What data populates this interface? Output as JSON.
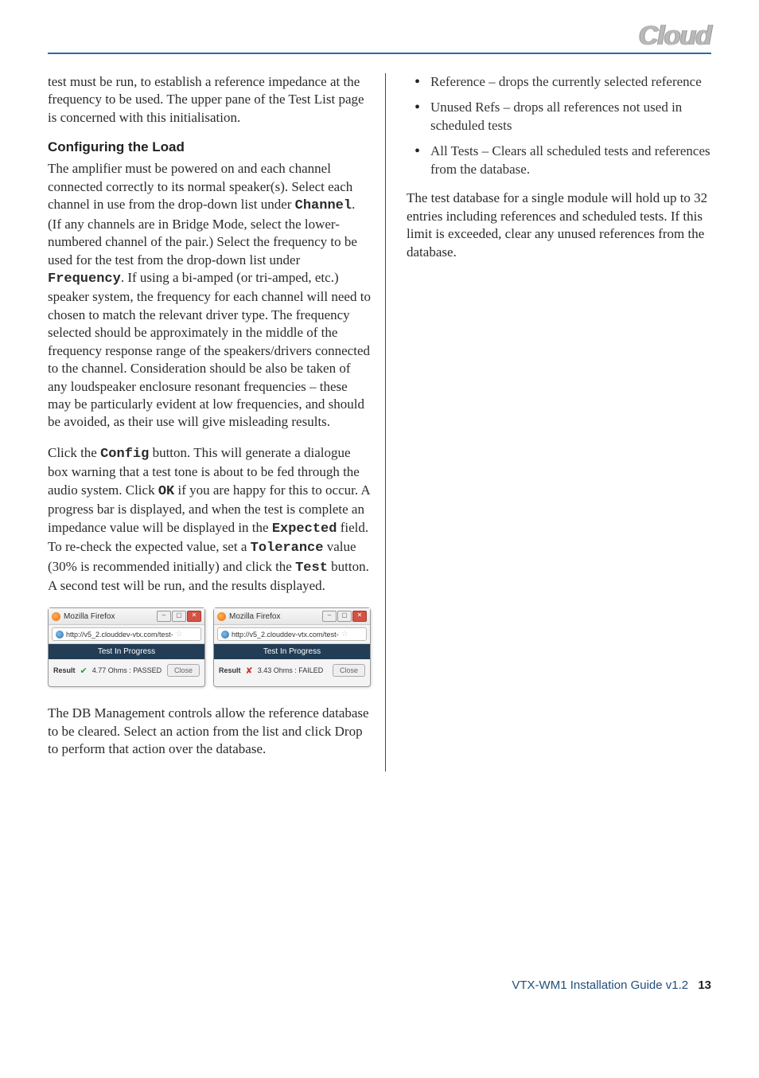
{
  "logo": "Cloud",
  "left": {
    "p1": "test must be run, to establish a reference impedance at the frequency to be used. The upper pane of the Test List page is concerned with this initialisation.",
    "h1": "Configuring the Load",
    "p2a": "The amplifier must be powered on and each channel connected correctly to its normal speaker(s). Select each channel in use from the drop-down list under ",
    "p2_channel": "Channel",
    "p2b": ". (If any channels are in Bridge Mode, select the lower-numbered channel of the pair.) Select the frequency to be used for the test from the drop-down list under ",
    "p2_frequency": "Frequency",
    "p2c": ". If using a bi-amped (or tri-amped, etc.) speaker system, the frequency for each channel will need to chosen to match the relevant driver type. The frequency selected should be approximately in the middle of the frequency response range of the speakers/drivers connected to the channel. Consideration should be also be taken of any loudspeaker enclosure resonant frequencies – these may be particularly evident at low frequencies, and should be avoided, as their use will give misleading results.",
    "p3a": "Click the ",
    "p3_config": "Config",
    "p3b": " button. This will generate a dialogue box warning that a test tone is about to be fed through the audio system. Click ",
    "p3_ok": "OK",
    "p3c": " if you are happy for this to occur. A progress bar is displayed, and when the test is complete an impedance value will be displayed in the ",
    "p3_expected": "Expected",
    "p3d": " field. To re-check the expected value, set a ",
    "p3_tolerance": "Tolerance",
    "p3e": " value (30% is recommended initially) and click the ",
    "p3_test": "Test",
    "p3f": " button. A second test will be run, and the results displayed.",
    "p4": "The DB Management controls allow the reference database to be cleared. Select an action from the list and click Drop to perform that action over the database."
  },
  "right": {
    "bullets": [
      "Reference – drops the currently  selected reference",
      "Unused Refs – drops all references not used in scheduled tests",
      "All Tests – Clears all scheduled tests and references from the database."
    ],
    "p1": "The test database for a single module will hold up to 32 entries including references and scheduled tests. If this limit is exceeded, clear any unused references from the database."
  },
  "popup": {
    "browser": "Mozilla Firefox",
    "url": "http://v5_2.clouddev-vtx.com/test-",
    "banner": "Test In Progress",
    "result_label": "Result",
    "pass_text": "4.77 Ohms : PASSED",
    "fail_text": "3.43 Ohms : FAILED",
    "close": "Close"
  },
  "footer": {
    "text": "VTX-WM1 Installation Guide v1.2",
    "page": "13"
  }
}
